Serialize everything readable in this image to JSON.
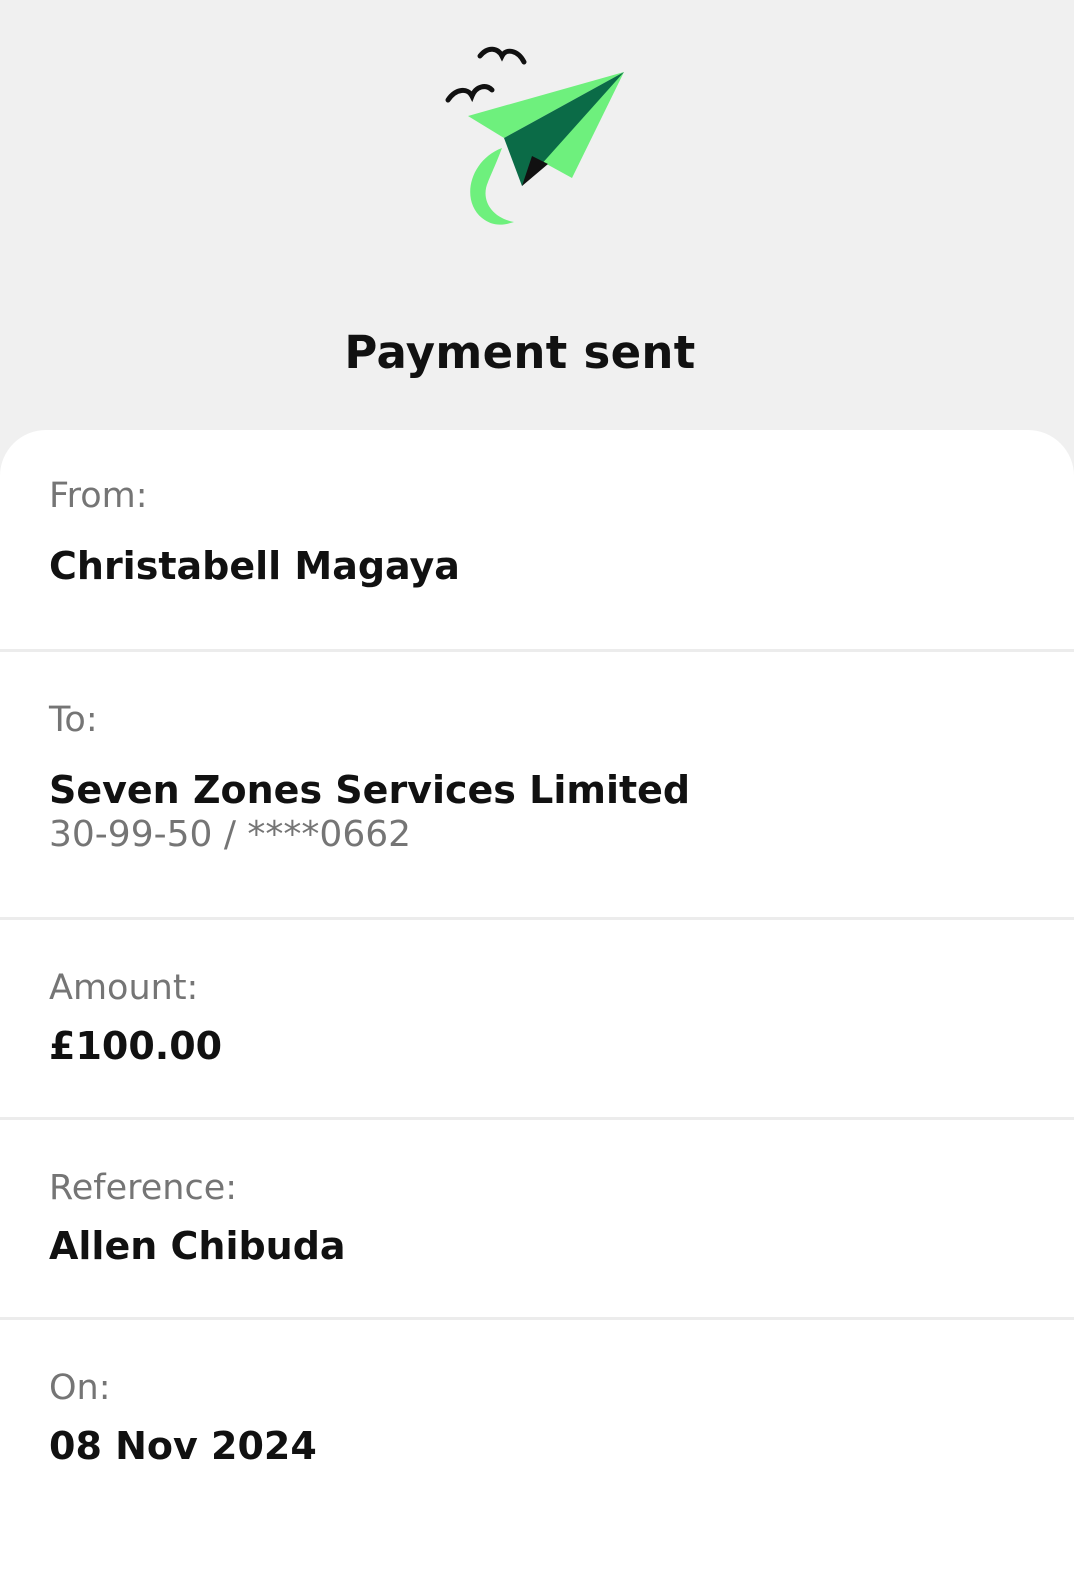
{
  "header": {
    "title": "Payment sent",
    "illustration": "paper-plane-icon",
    "accent_color": "#6ef07d",
    "accent_dark": "#0b6b47"
  },
  "details": {
    "from": {
      "label": "From:",
      "value": "Christabell Magaya"
    },
    "to": {
      "label": "To:",
      "value": "Seven Zones Services Limited",
      "account": "30-99-50 / ****0662"
    },
    "amount": {
      "label": "Amount:",
      "value": "£100.00"
    },
    "reference": {
      "label": "Reference:",
      "value": "Allen Chibuda"
    },
    "on": {
      "label": "On:",
      "value": "08 Nov 2024"
    }
  }
}
